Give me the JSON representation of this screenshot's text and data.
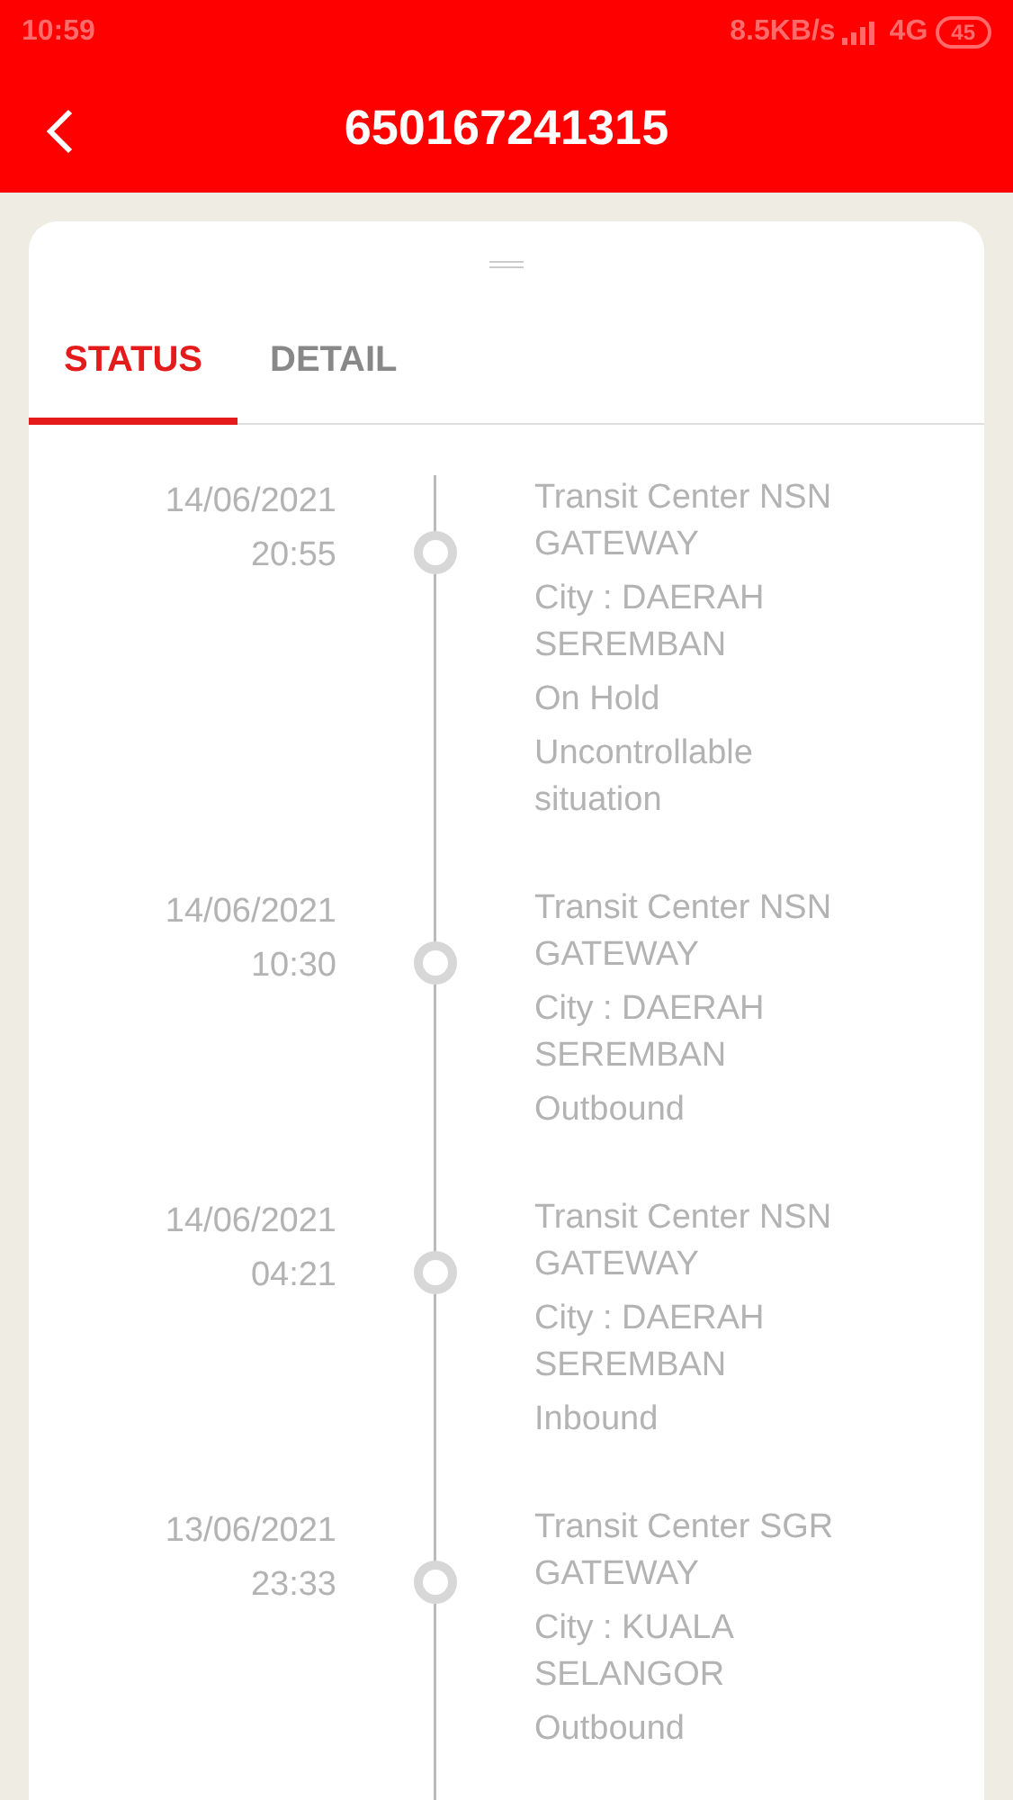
{
  "status_bar": {
    "time": "10:59",
    "speed": "8.5KB/s",
    "network": "4G",
    "battery": "45"
  },
  "header": {
    "title": "650167241315"
  },
  "tabs": [
    {
      "label": "STATUS",
      "selected": true
    },
    {
      "label": "DETAIL",
      "selected": false
    }
  ],
  "events": [
    {
      "date": "14/06/2021",
      "time": "20:55",
      "location": "Transit Center NSN GATEWAY",
      "city": "City : DAERAH SEREMBAN",
      "statuses": [
        "On Hold",
        "Uncontrollable situation"
      ]
    },
    {
      "date": "14/06/2021",
      "time": "10:30",
      "location": "Transit Center NSN GATEWAY",
      "city": "City : DAERAH SEREMBAN",
      "statuses": [
        "Outbound"
      ]
    },
    {
      "date": "14/06/2021",
      "time": "04:21",
      "location": "Transit Center NSN GATEWAY",
      "city": "City : DAERAH SEREMBAN",
      "statuses": [
        "Inbound"
      ]
    },
    {
      "date": "13/06/2021",
      "time": "23:33",
      "location": "Transit Center SGR GATEWAY",
      "city": "City : KUALA SELANGOR",
      "statuses": [
        "Outbound"
      ]
    }
  ]
}
